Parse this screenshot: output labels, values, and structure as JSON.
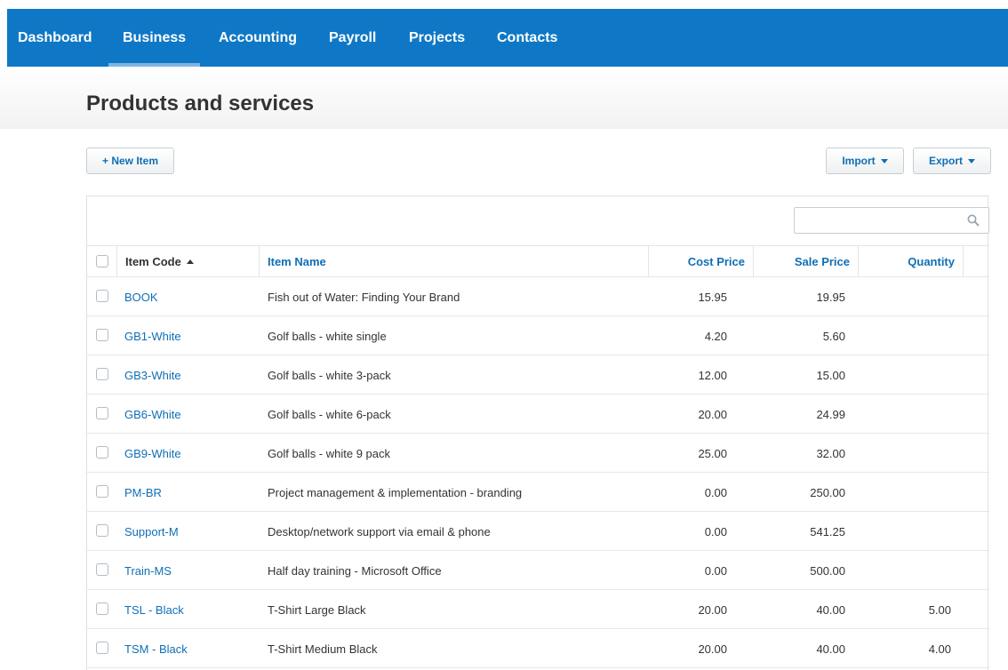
{
  "nav": {
    "items": [
      {
        "label": "Dashboard",
        "active": false
      },
      {
        "label": "Business",
        "active": true
      },
      {
        "label": "Accounting",
        "active": false
      },
      {
        "label": "Payroll",
        "active": false
      },
      {
        "label": "Projects",
        "active": false
      },
      {
        "label": "Contacts",
        "active": false
      }
    ]
  },
  "page": {
    "title": "Products and services"
  },
  "toolbar": {
    "new_item": "+ New Item",
    "import": "Import",
    "export": "Export"
  },
  "search": {
    "value": "",
    "icon": "search-icon"
  },
  "table": {
    "columns": {
      "code": "Item Code",
      "name": "Item Name",
      "cost": "Cost Price",
      "sale": "Sale Price",
      "qty": "Quantity"
    },
    "sorted_by": "code",
    "rows": [
      {
        "code": "BOOK",
        "name": "Fish out of Water: Finding Your Brand",
        "cost": "15.95",
        "sale": "19.95",
        "qty": ""
      },
      {
        "code": "GB1-White",
        "name": "Golf balls - white single",
        "cost": "4.20",
        "sale": "5.60",
        "qty": ""
      },
      {
        "code": "GB3-White",
        "name": "Golf balls - white 3-pack",
        "cost": "12.00",
        "sale": "15.00",
        "qty": ""
      },
      {
        "code": "GB6-White",
        "name": "Golf balls - white 6-pack",
        "cost": "20.00",
        "sale": "24.99",
        "qty": ""
      },
      {
        "code": "GB9-White",
        "name": "Golf balls - white 9 pack",
        "cost": "25.00",
        "sale": "32.00",
        "qty": ""
      },
      {
        "code": "PM-BR",
        "name": "Project management & implementation - branding",
        "cost": "0.00",
        "sale": "250.00",
        "qty": ""
      },
      {
        "code": "Support-M",
        "name": "Desktop/network support via email & phone",
        "cost": "0.00",
        "sale": "541.25",
        "qty": ""
      },
      {
        "code": "Train-MS",
        "name": "Half day training - Microsoft Office",
        "cost": "0.00",
        "sale": "500.00",
        "qty": ""
      },
      {
        "code": "TSL - Black",
        "name": "T-Shirt Large Black",
        "cost": "20.00",
        "sale": "40.00",
        "qty": "5.00"
      },
      {
        "code": "TSM - Black",
        "name": "T-Shirt Medium Black",
        "cost": "20.00",
        "sale": "40.00",
        "qty": "4.00"
      }
    ]
  },
  "colors": {
    "nav_bg": "#0f78c6",
    "link": "#0f6fb5",
    "text": "#333333"
  }
}
